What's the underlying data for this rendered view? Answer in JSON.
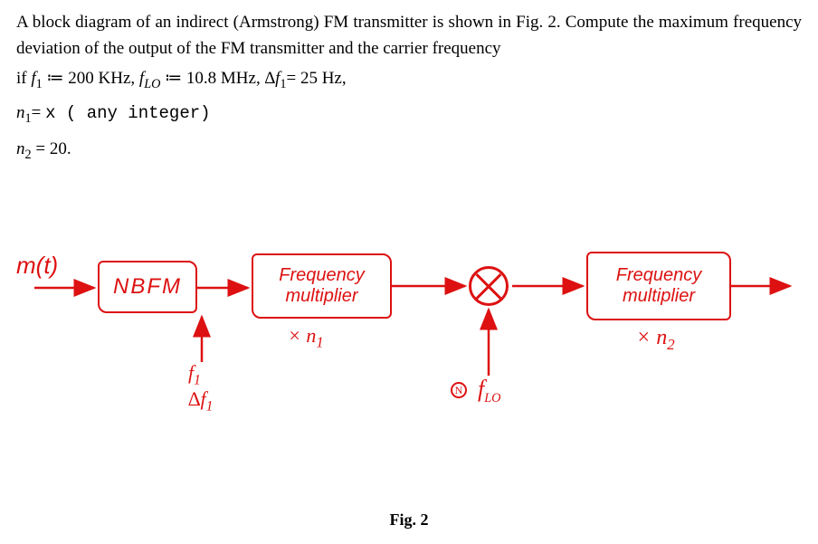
{
  "problem": {
    "line1": "A block diagram of an indirect (Armstrong) FM transmitter is shown in Fig. 2. Compute the maximum frequency deviation of the output of the FM transmitter and the carrier frequency",
    "line2_prefix": "if ",
    "f1_sym": "f",
    "f1_sub": "1",
    "f1_val": " ≔ 200 KHz, ",
    "flo_sym": "f",
    "flo_sub": "LO",
    "flo_val": " ≔ 10.8 MHz, ",
    "df1_sym": "∆f",
    "df1_sub": "1",
    "df1_val": "= 25 Hz,",
    "n1_sym": "n",
    "n1_sub": "1",
    "n1_val": "= ",
    "n1_x": "x ( any integer)",
    "n2_sym": "n",
    "n2_sub": "2",
    "n2_val": " = 20."
  },
  "diagram": {
    "mt": "m(t)",
    "nbfm": "NBFM",
    "mult1_l1": "Frequency",
    "mult1_l2": "multiplier",
    "xn1": "× n",
    "xn1_sub": "1",
    "mult2_l1": "Frequency",
    "mult2_l2": "multiplier",
    "xn2": "× n",
    "xn2_sub": "2",
    "f1_lbl": "f",
    "f1_lbl_sub": "1",
    "df1_lbl": "∆f",
    "df1_lbl_sub": "1",
    "lo_sym_n": "N",
    "flo_lbl": "f",
    "flo_lbl_sub": "LO"
  },
  "caption": "Fig. 2"
}
